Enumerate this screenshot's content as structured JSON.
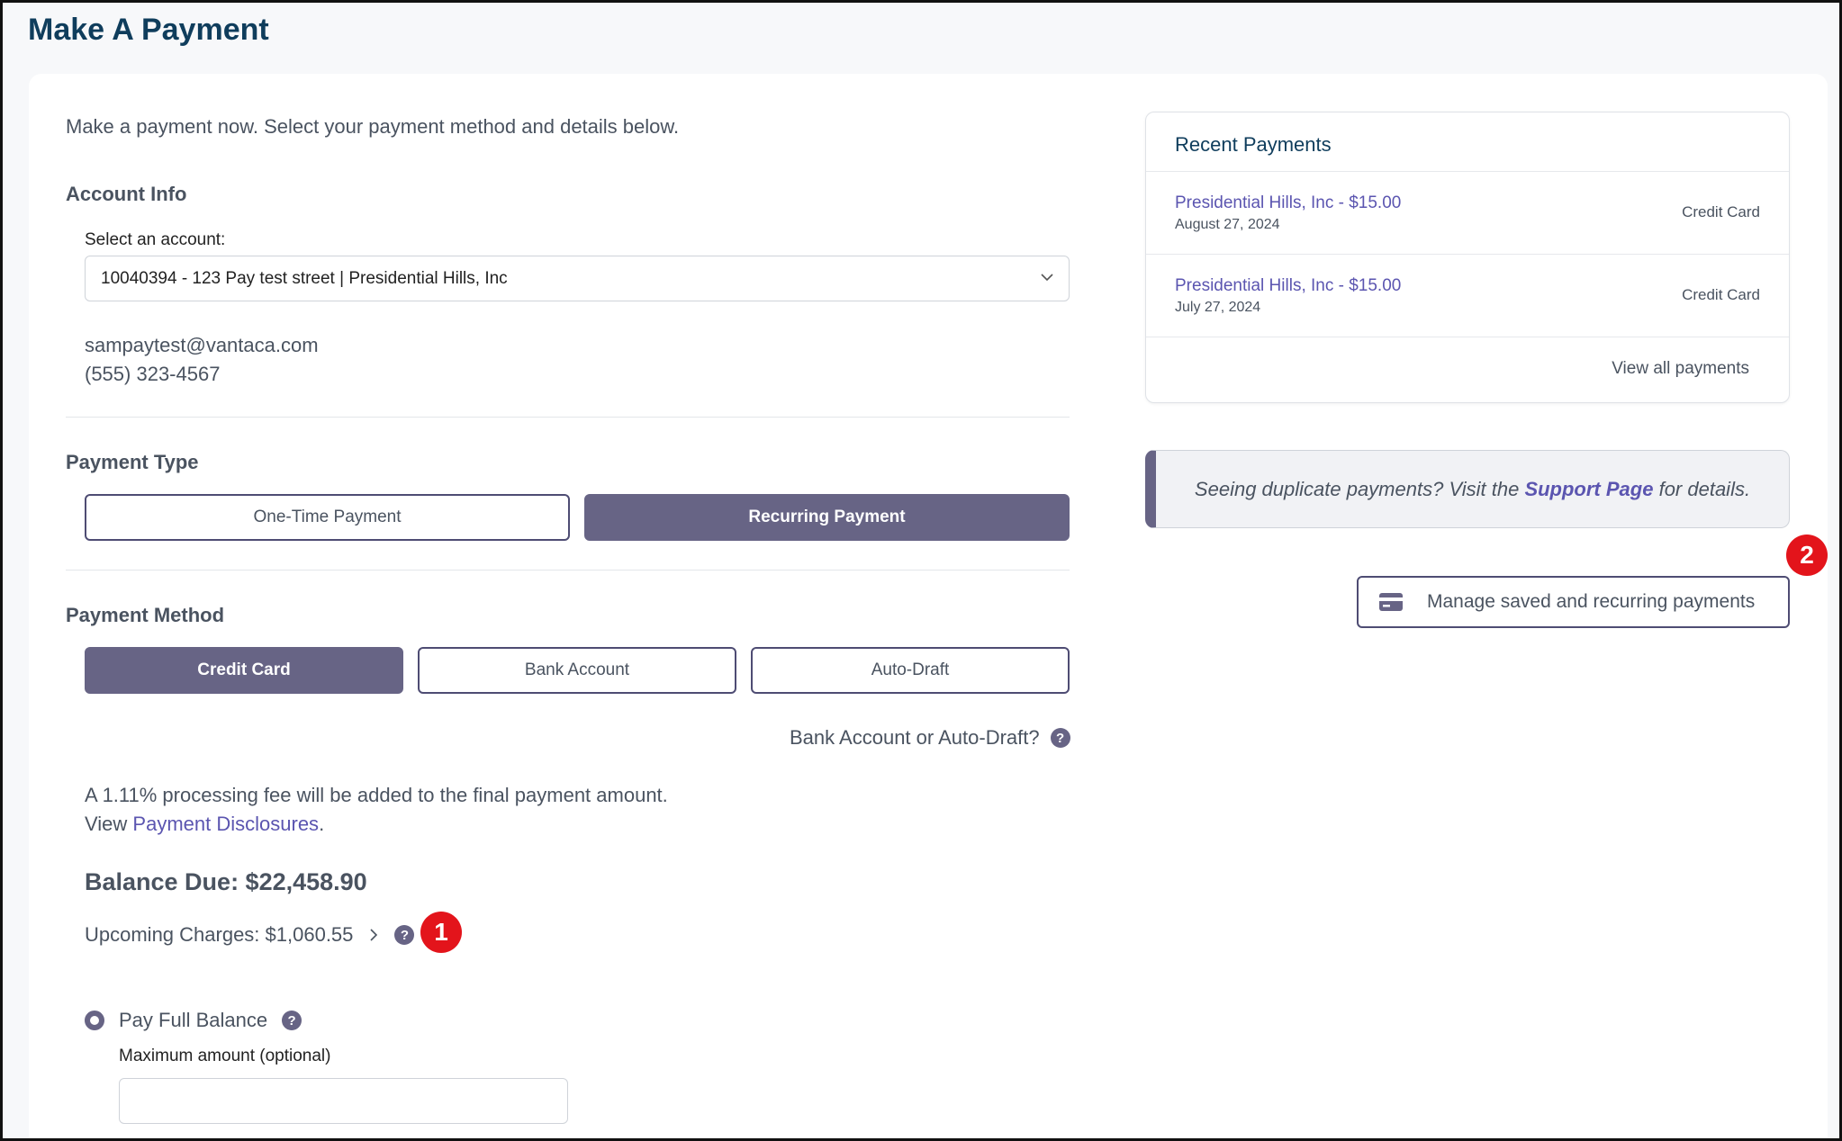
{
  "page": {
    "title": "Make A Payment",
    "intro": "Make a payment now. Select your payment method and details below."
  },
  "account_info": {
    "heading": "Account Info",
    "select_label": "Select an account:",
    "selected_account": "10040394 - 123 Pay test street | Presidential Hills, Inc",
    "email": "sampaytest@vantaca.com",
    "phone": "(555) 323-4567"
  },
  "payment_type": {
    "heading": "Payment Type",
    "options": [
      "One-Time Payment",
      "Recurring Payment"
    ],
    "selected": "Recurring Payment"
  },
  "payment_method": {
    "heading": "Payment Method",
    "options": [
      "Credit Card",
      "Bank Account",
      "Auto-Draft"
    ],
    "selected": "Credit Card",
    "help_text": "Bank Account or Auto-Draft?"
  },
  "fee": {
    "text": "A 1.11% processing fee will be added to the final payment amount.",
    "view_prefix": "View",
    "disclosures_link": "Payment Disclosures",
    "period": "."
  },
  "balance": {
    "due": "Balance Due: $22,458.90",
    "upcoming": "Upcoming Charges: $1,060.55"
  },
  "pay_full": {
    "label": "Pay Full Balance",
    "max_label": "Maximum amount (optional)",
    "max_value": ""
  },
  "recent_payments": {
    "heading": "Recent Payments",
    "items": [
      {
        "title": "Presidential Hills, Inc - $15.00",
        "date": "August 27, 2024",
        "method": "Credit Card"
      },
      {
        "title": "Presidential Hills, Inc - $15.00",
        "date": "July 27, 2024",
        "method": "Credit Card"
      }
    ],
    "view_all": "View all payments"
  },
  "notice": {
    "prefix": "Seeing duplicate payments? Visit the",
    "link": "Support Page",
    "suffix": "for details."
  },
  "manage_button": "Manage saved and recurring payments",
  "markers": [
    "1",
    "2"
  ],
  "icons": {
    "chevron": "chevron-down-icon",
    "help": "question-circle-icon",
    "card": "credit-card-icon",
    "chevron_right": "chevron-right-icon"
  },
  "colors": {
    "accent": "#676485",
    "title": "#0f3d5c",
    "link": "#5b55b0",
    "marker": "#e3141b"
  }
}
